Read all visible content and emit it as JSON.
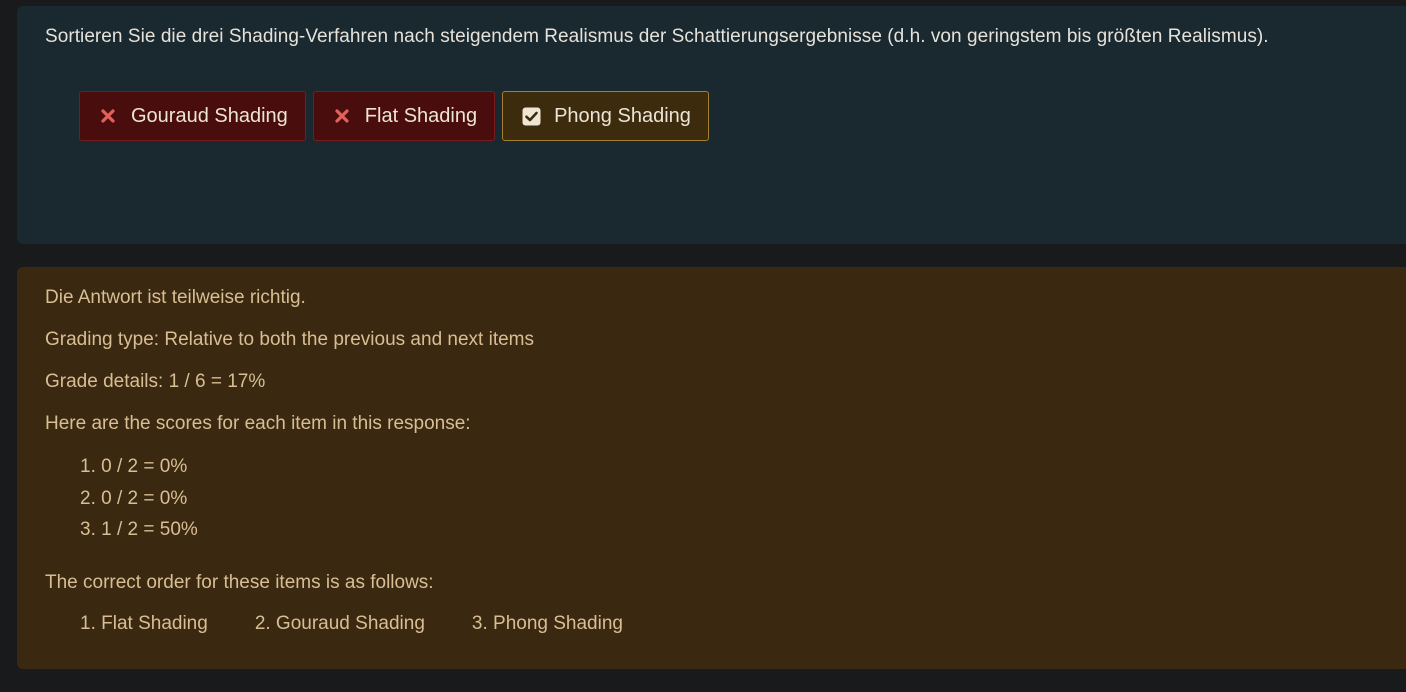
{
  "question": {
    "text": "Sortieren Sie die drei Shading-Verfahren nach steigendem Realismus der Schattierungsergebnisse (d.h. von geringstem bis größten Realismus).",
    "items": [
      {
        "label": "Gouraud Shading",
        "status": "incorrect",
        "icon": "x-mark-icon"
      },
      {
        "label": "Flat Shading",
        "status": "incorrect",
        "icon": "x-mark-icon"
      },
      {
        "label": "Phong Shading",
        "status": "correct",
        "icon": "check-square-icon"
      }
    ]
  },
  "feedback": {
    "status": "Die Antwort ist teilweise richtig.",
    "grading_type": "Grading type: Relative to both the previous and next items",
    "grade_details": "Grade details: 1 / 6 = 17%",
    "scores_intro": "Here are the scores for each item in this response:",
    "scores": [
      "1. 0 / 2 = 0%",
      "2. 0 / 2 = 0%",
      "3. 1 / 2 = 50%"
    ],
    "order_intro": "The correct order for these items is as follows:",
    "correct_order": [
      "1. Flat Shading",
      "2. Gouraud Shading",
      "3. Phong Shading"
    ]
  },
  "colors": {
    "incorrect_mark": "#e0625a",
    "correct_mark": "#efe6d4",
    "question_bg": "#1a2830",
    "feedback_bg": "#3b2810"
  }
}
